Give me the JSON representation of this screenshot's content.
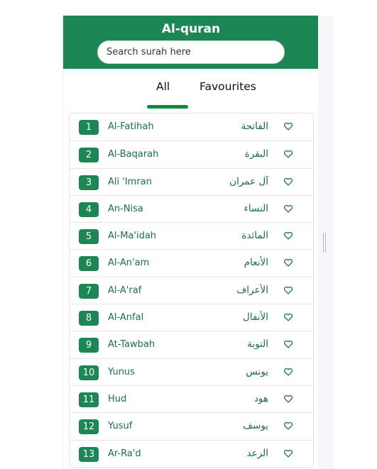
{
  "header": {
    "title": "Al-quran",
    "search_placeholder": "Search surah here",
    "background": "#1c8654"
  },
  "tabs": [
    {
      "label": "All",
      "active": true
    },
    {
      "label": "Favourites",
      "active": false
    }
  ],
  "accent": "#0c8a3c",
  "surahs": [
    {
      "number": "1",
      "name": "Al-Fatihah",
      "arabic": "الفاتحة"
    },
    {
      "number": "2",
      "name": "Al-Baqarah",
      "arabic": "البقرة"
    },
    {
      "number": "3",
      "name": "Ali 'Imran",
      "arabic": "آل عمران"
    },
    {
      "number": "4",
      "name": "An-Nisa",
      "arabic": "النساء"
    },
    {
      "number": "5",
      "name": "Al-Ma'idah",
      "arabic": "المائدة"
    },
    {
      "number": "6",
      "name": "Al-An'am",
      "arabic": "الأنعام"
    },
    {
      "number": "7",
      "name": "Al-A'raf",
      "arabic": "الأعراف"
    },
    {
      "number": "8",
      "name": "Al-Anfal",
      "arabic": "الأنفال"
    },
    {
      "number": "9",
      "name": "At-Tawbah",
      "arabic": "التوبة"
    },
    {
      "number": "10",
      "name": "Yunus",
      "arabic": "يونس"
    },
    {
      "number": "11",
      "name": "Hud",
      "arabic": "هود"
    },
    {
      "number": "12",
      "name": "Yusuf",
      "arabic": "يوسف"
    },
    {
      "number": "13",
      "name": "Ar-Ra'd",
      "arabic": "الرعد"
    }
  ],
  "row_icon": "heart-outline-icon"
}
